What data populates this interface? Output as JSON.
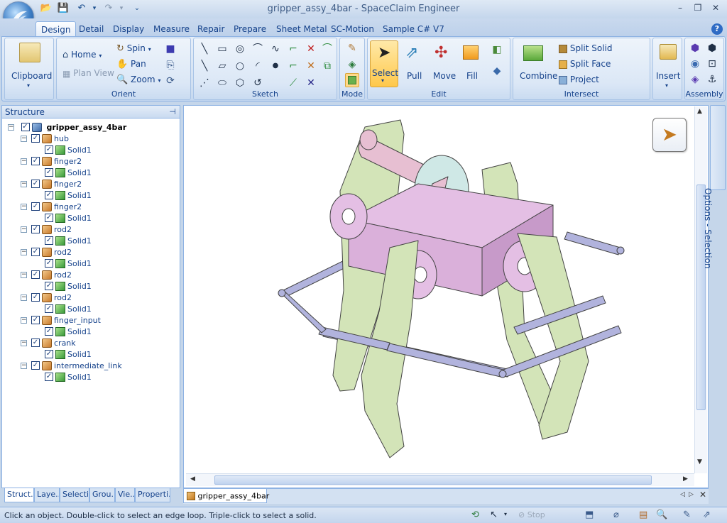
{
  "window": {
    "title": "gripper_assy_4bar - SpaceClaim Engineer",
    "minimize": "–",
    "restore": "❐",
    "close": "✕"
  },
  "tabs": [
    "Design",
    "Detail",
    "Display",
    "Measure",
    "Repair",
    "Prepare",
    "Sheet Metal",
    "SC-Motion",
    "Sample C# V7"
  ],
  "active_tab": "Design",
  "ribbon": {
    "clipboard": {
      "label": "Clipboard"
    },
    "orient": {
      "label": "Orient",
      "home": "Home",
      "plan_view": "Plan View",
      "spin": "Spin",
      "pan": "Pan",
      "zoom": "Zoom"
    },
    "sketch": {
      "label": "Sketch"
    },
    "mode": {
      "label": "Mode"
    },
    "edit": {
      "label": "Edit",
      "select": "Select",
      "pull": "Pull",
      "move": "Move",
      "fill": "Fill"
    },
    "intersect": {
      "label": "Intersect",
      "combine": "Combine",
      "split_solid": "Split Solid",
      "split_face": "Split Face",
      "project": "Project"
    },
    "insert": {
      "label": "Insert"
    },
    "assembly": {
      "label": "Assembly"
    }
  },
  "structure": {
    "title": "Structure",
    "pin": "⊣",
    "root": "gripper_assy_4bar",
    "items": [
      {
        "name": "hub",
        "child": "Solid1"
      },
      {
        "name": "finger2",
        "child": "Solid1"
      },
      {
        "name": "finger2",
        "child": "Solid1"
      },
      {
        "name": "finger2",
        "child": "Solid1"
      },
      {
        "name": "rod2",
        "child": "Solid1"
      },
      {
        "name": "rod2",
        "child": "Solid1"
      },
      {
        "name": "rod2",
        "child": "Solid1"
      },
      {
        "name": "rod2",
        "child": "Solid1"
      },
      {
        "name": "finger_input",
        "child": "Solid1"
      },
      {
        "name": "crank",
        "child": "Solid1"
      },
      {
        "name": "intermediate_link",
        "child": "Solid1"
      }
    ]
  },
  "panel_tabs": [
    "Struct...",
    "Laye...",
    "Selecti...",
    "Grou...",
    "Vie...",
    "Properti..."
  ],
  "document_tab": "gripper_assy_4bar",
  "options_panel": "Options - Selection",
  "status": {
    "hint": "Click an object. Double-click to select an edge loop. Triple-click to select a solid.",
    "stop": "Stop"
  },
  "colors": {
    "finger": "#d3e4b8",
    "hub": "#e4bfe4",
    "crank": "#e7bfd2",
    "disc": "#cfe8e6",
    "rod": "#b1b3dd",
    "ribbon_border": "#8db2e3",
    "text": "#15428b"
  }
}
